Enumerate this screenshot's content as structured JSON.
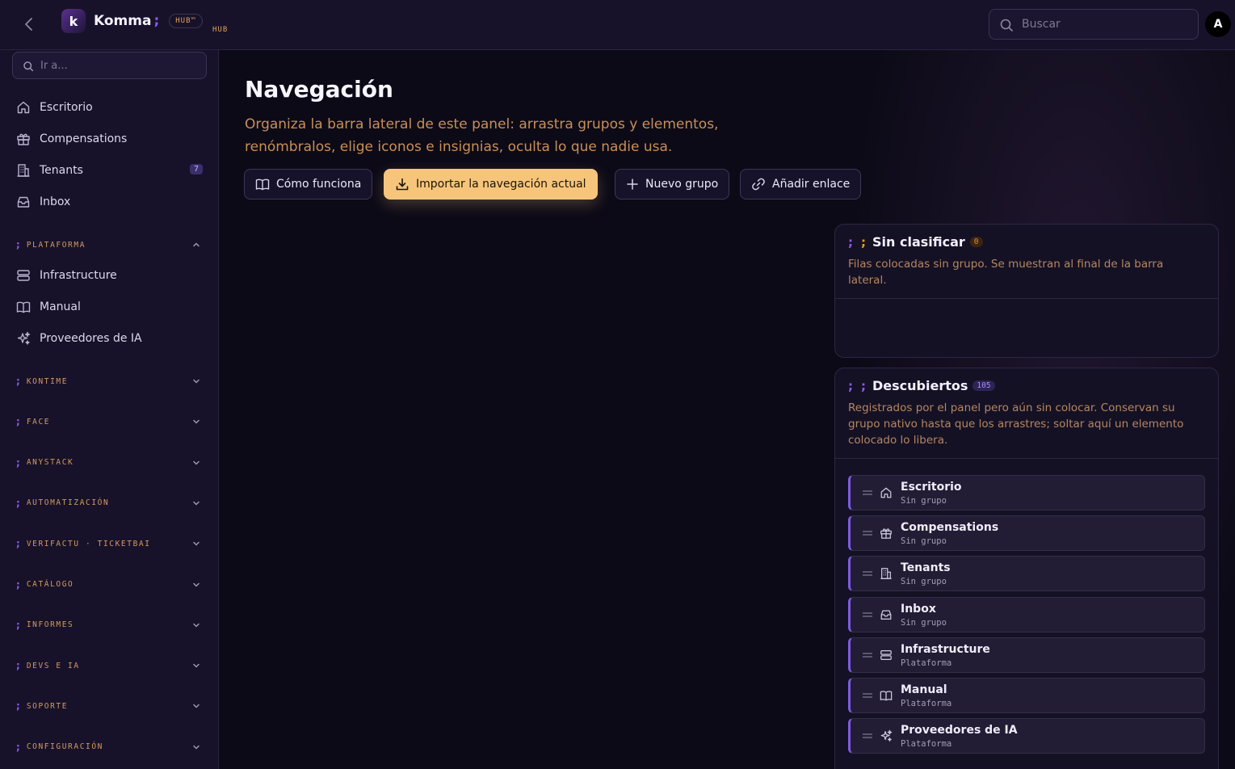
{
  "topbar": {
    "brand_logo": "k",
    "brand_name": "Komma",
    "brand_semicolon": ";",
    "hub_pill": "HUB™",
    "hub_sub": "HUB",
    "search_placeholder": "Buscar",
    "avatar_initial": "A"
  },
  "sidebar": {
    "search_placeholder": "Ir a...",
    "top_items": [
      {
        "label": "Escritorio",
        "icon": "home-icon"
      },
      {
        "label": "Compensations",
        "icon": "gift-icon"
      },
      {
        "label": "Tenants",
        "icon": "building-icon",
        "badge": "7"
      },
      {
        "label": "Inbox",
        "icon": "inbox-icon"
      }
    ],
    "plataforma": {
      "label": "PLATAFORMA",
      "expanded": true,
      "items": [
        {
          "label": "Infrastructure",
          "icon": "server-icon"
        },
        {
          "label": "Manual",
          "icon": "book-icon"
        },
        {
          "label": "Proveedores de IA",
          "icon": "sparkles-icon"
        }
      ]
    },
    "groups": [
      {
        "label": "KONTIME"
      },
      {
        "label": "FACE"
      },
      {
        "label": "ANYSTACK"
      },
      {
        "label": "AUTOMATIZACIÓN"
      },
      {
        "label": "VERIFACTU · TICKETBAI"
      },
      {
        "label": "CATÁLOGO"
      },
      {
        "label": "INFORMES"
      },
      {
        "label": "DEVS E IA"
      },
      {
        "label": "SOPORTE"
      },
      {
        "label": "CONFIGURACIÓN"
      }
    ],
    "group_semicolon": ";"
  },
  "main": {
    "title": "Navegación",
    "description": "Organiza la barra lateral de este panel: arrastra grupos y elementos, renómbralos, elige iconos e insignias, oculta lo que nadie usa.",
    "buttons": {
      "how": "Cómo funciona",
      "import": "Importar la navegación actual",
      "new_group": "Nuevo grupo",
      "add_link": "Añadir enlace"
    }
  },
  "unclassified": {
    "semi_a": ";",
    "semi_b": ";",
    "title": "Sin clasificar",
    "count": "0",
    "description": "Filas colocadas sin grupo. Se muestran al final de la barra lateral."
  },
  "discovered": {
    "semi_a": ";",
    "semi_b": ";",
    "title": "Descubiertos",
    "count": "105",
    "description": "Registrados por el panel pero aún sin colocar. Conservan su grupo nativo hasta que los arrastres; soltar aquí un elemento colocado lo libera.",
    "rows": [
      {
        "name": "Escritorio",
        "group": "Sin grupo",
        "icon": "home-icon"
      },
      {
        "name": "Compensations",
        "group": "Sin grupo",
        "icon": "gift-icon"
      },
      {
        "name": "Tenants",
        "group": "Sin grupo",
        "icon": "building-icon"
      },
      {
        "name": "Inbox",
        "group": "Sin grupo",
        "icon": "inbox-icon"
      },
      {
        "name": "Infrastructure",
        "group": "Plataforma",
        "icon": "server-icon"
      },
      {
        "name": "Manual",
        "group": "Plataforma",
        "icon": "book-icon"
      },
      {
        "name": "Proveedores de IA",
        "group": "Plataforma",
        "icon": "sparkles-icon"
      }
    ]
  },
  "colors": {
    "accent_purple": "#8b5cf6",
    "accent_orange": "#e0a15a",
    "primary_button": "#f6c57b",
    "background": "#0c0a17",
    "surface": "#17122a"
  }
}
